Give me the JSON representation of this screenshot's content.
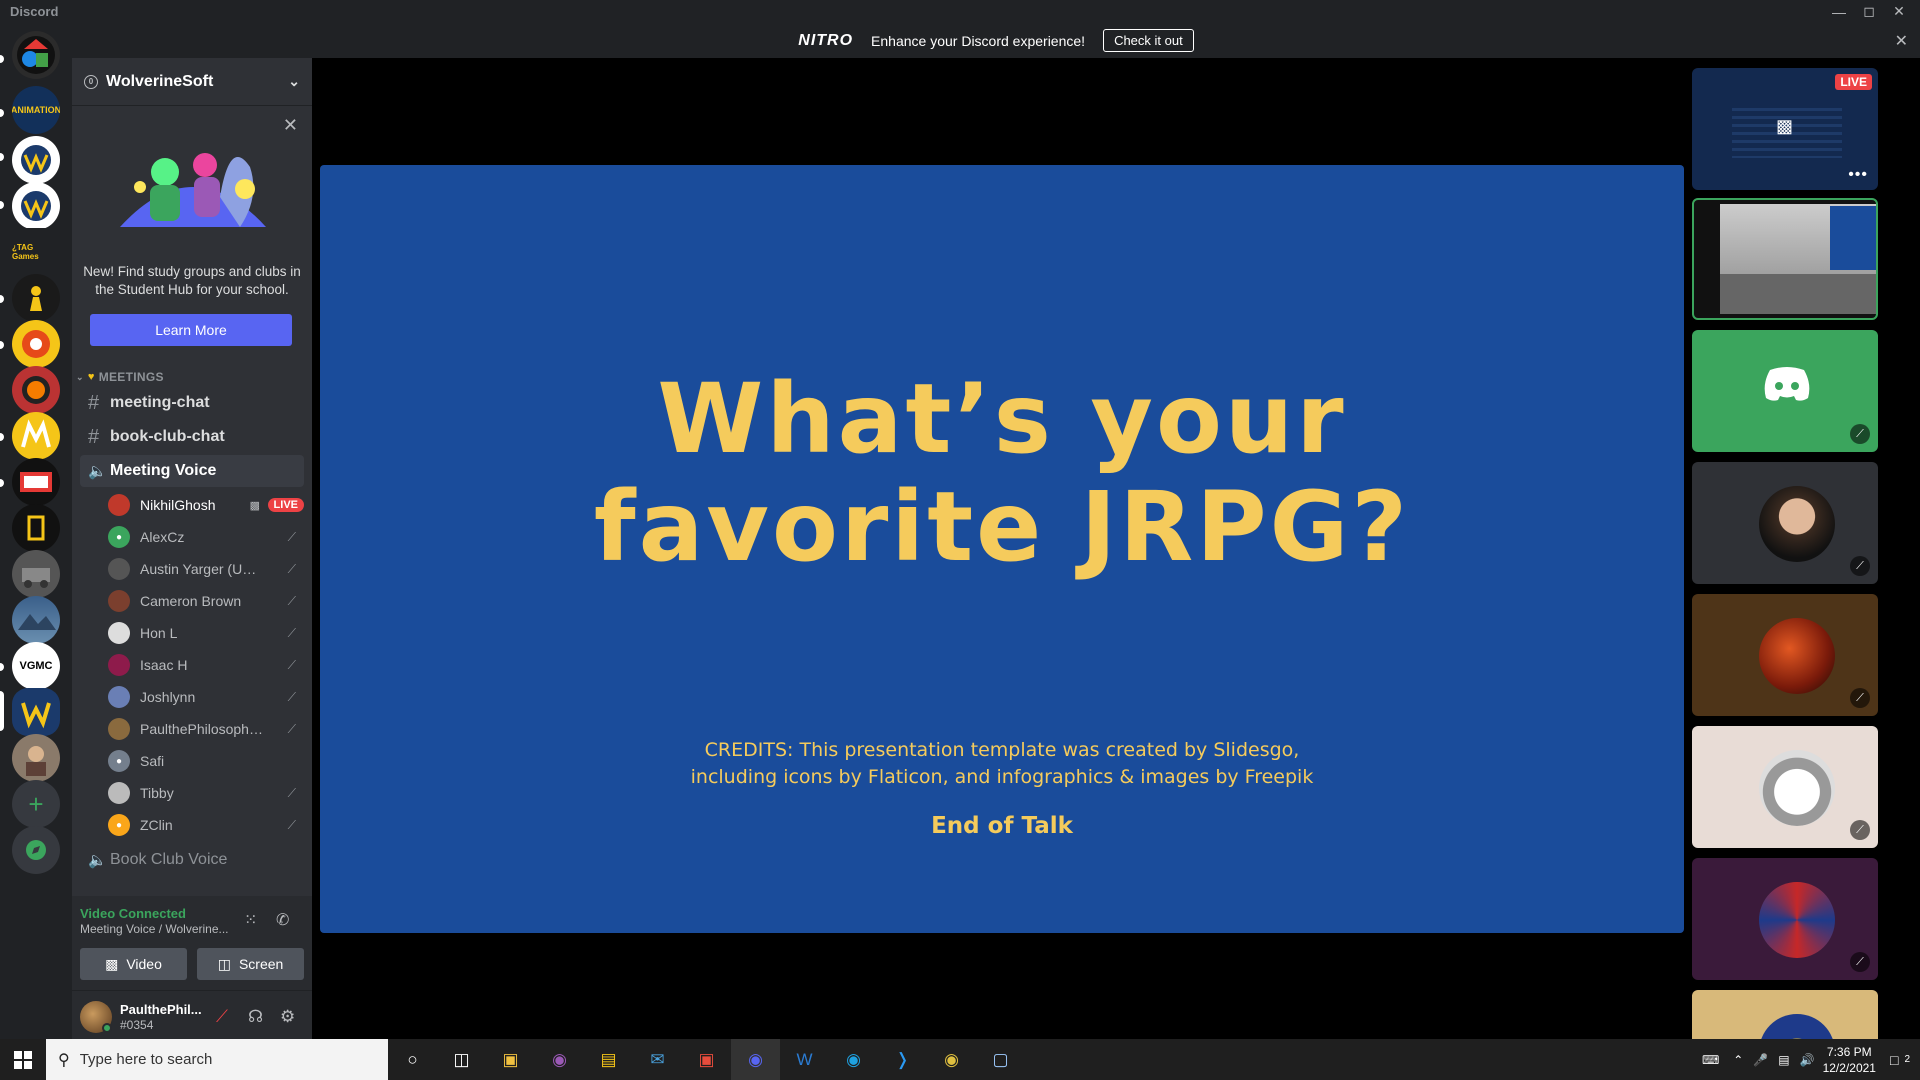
{
  "window": {
    "title": "Discord"
  },
  "nitro": {
    "logo": "NITRO",
    "message": "Enhance your Discord experience!",
    "cta": "Check it out"
  },
  "server": {
    "name": "WolverineSoft"
  },
  "hub": {
    "text": "New! Find study groups and clubs in the Student Hub for your school.",
    "button": "Learn More"
  },
  "category": {
    "name": "MEETINGS"
  },
  "channels": {
    "meeting_chat": "meeting-chat",
    "book_club_chat": "book-club-chat",
    "meeting_voice": "Meeting Voice",
    "book_club_voice": "Book Club Voice"
  },
  "voice_users": [
    {
      "name": "NikhilGhosh",
      "badge": "LIVE"
    },
    {
      "name": "AlexCz"
    },
    {
      "name": "Austin Yarger (UMi..."
    },
    {
      "name": "Cameron Brown"
    },
    {
      "name": "Hon L"
    },
    {
      "name": "Isaac H"
    },
    {
      "name": "Joshlynn"
    },
    {
      "name": "PaulthePhilosophy..."
    },
    {
      "name": "Safi"
    },
    {
      "name": "Tibby"
    },
    {
      "name": "ZClin"
    }
  ],
  "voice_panel": {
    "status": "Video Connected",
    "location": "Meeting Voice / Wolverine...",
    "video_label": "Video",
    "screen_label": "Screen"
  },
  "user_panel": {
    "name": "PaulthePhil...",
    "tag": "#0354"
  },
  "guild_labels": {
    "animation": "ANIMATION",
    "vgmc": "VGMC",
    "tag_games": "¿TAG Games"
  },
  "slide": {
    "heading_line1": "What’s your",
    "heading_line2": "favorite JRPG?",
    "credits_line1": "CREDITS: This presentation template was created by Slidesgo,",
    "credits_line2": "including icons by Flaticon, and infographics & images by Freepik",
    "end": "End of Talk"
  },
  "tiles": {
    "live_badge": "LIVE"
  },
  "taskbar": {
    "search_placeholder": "Type here to search",
    "time": "7:36 PM",
    "date": "12/2/2021",
    "notification_count": "2"
  }
}
